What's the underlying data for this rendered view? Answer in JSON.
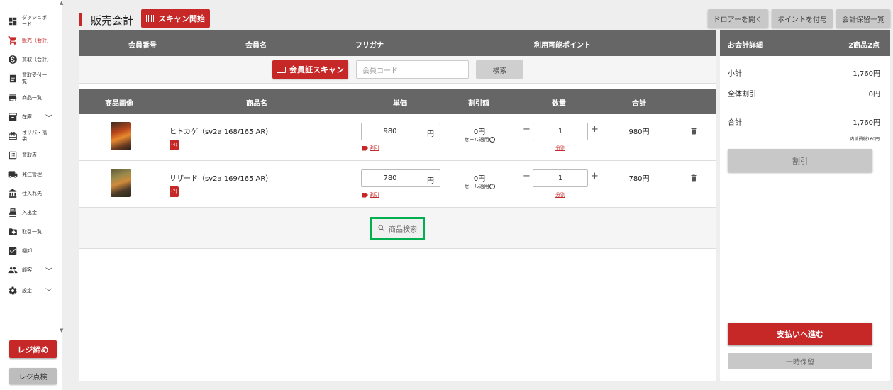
{
  "sidebar": {
    "items": [
      {
        "label": "ダッシュボード",
        "icon": "dashboard-icon",
        "active": false
      },
      {
        "label": "販売（会計）",
        "icon": "cart-icon",
        "active": true
      },
      {
        "label": "買取（会計）",
        "icon": "dollar-icon",
        "active": false
      },
      {
        "label": "買取受付一覧",
        "icon": "receipt-icon",
        "active": false
      },
      {
        "label": "商品一覧",
        "icon": "store-icon",
        "active": false
      },
      {
        "label": "在庫",
        "icon": "inventory-icon",
        "active": false
      },
      {
        "label": "オリパ・福袋",
        "icon": "gift-icon",
        "active": false
      },
      {
        "label": "買取表",
        "icon": "list-icon",
        "active": false
      },
      {
        "label": "発注管理",
        "icon": "truck-icon",
        "active": false
      },
      {
        "label": "仕入れ先",
        "icon": "bank-icon",
        "active": false
      },
      {
        "label": "入出金",
        "icon": "cash-register-icon",
        "active": false
      },
      {
        "label": "取引一覧",
        "icon": "folder-icon",
        "active": false
      },
      {
        "label": "棚卸",
        "icon": "checkbox-icon",
        "active": false
      },
      {
        "label": "顧客",
        "icon": "people-icon",
        "active": false
      },
      {
        "label": "設定",
        "icon": "gear-icon",
        "active": false
      }
    ],
    "close_register": "レジ締め",
    "check_register": "レジ点検"
  },
  "header": {
    "title": "販売会計",
    "scan_button": "スキャン開始",
    "right_buttons": [
      "ドロアーを開く",
      "ポイントを付与",
      "会計保留一覧"
    ]
  },
  "member": {
    "headers": [
      "会員番号",
      "会員名",
      "フリガナ",
      "利用可能ポイント"
    ],
    "scan_button": "会員証スキャン",
    "code_placeholder": "会員コード",
    "search_button": "検索"
  },
  "items_table": {
    "headers": [
      "商品画像",
      "商品名",
      "単価",
      "割引額",
      "数量",
      "合計"
    ],
    "rows": [
      {
        "name": "ヒトカゲ（sv2a 168/165 AR）",
        "badge": "(4)",
        "price": "980",
        "yen": "円",
        "discount_link": "割引",
        "discount_amount": "0円",
        "sale_note": "セール適用",
        "qty": "1",
        "split_link": "分割",
        "total": "980円"
      },
      {
        "name": "リザード（sv2a 169/165 AR）",
        "badge": "(7)",
        "price": "780",
        "yen": "円",
        "discount_link": "割引",
        "discount_amount": "0円",
        "sale_note": "セール適用",
        "qty": "1",
        "split_link": "分割",
        "total": "780円"
      }
    ],
    "product_search_button": "商品検索"
  },
  "summary": {
    "title": "お会計詳細",
    "count": "2商品2点",
    "subtotal_label": "小計",
    "subtotal_value": "1,760円",
    "overall_discount_label": "全体割引",
    "overall_discount_value": "0円",
    "total_label": "合計",
    "total_value": "1,760円",
    "tax_note": "内消費税160円",
    "discount_button": "割引",
    "pay_button": "支払いへ進む",
    "hold_button": "一時保留"
  },
  "colors": {
    "accent": "#c62828",
    "header_gray": "#666666",
    "highlight": "#00b050"
  }
}
